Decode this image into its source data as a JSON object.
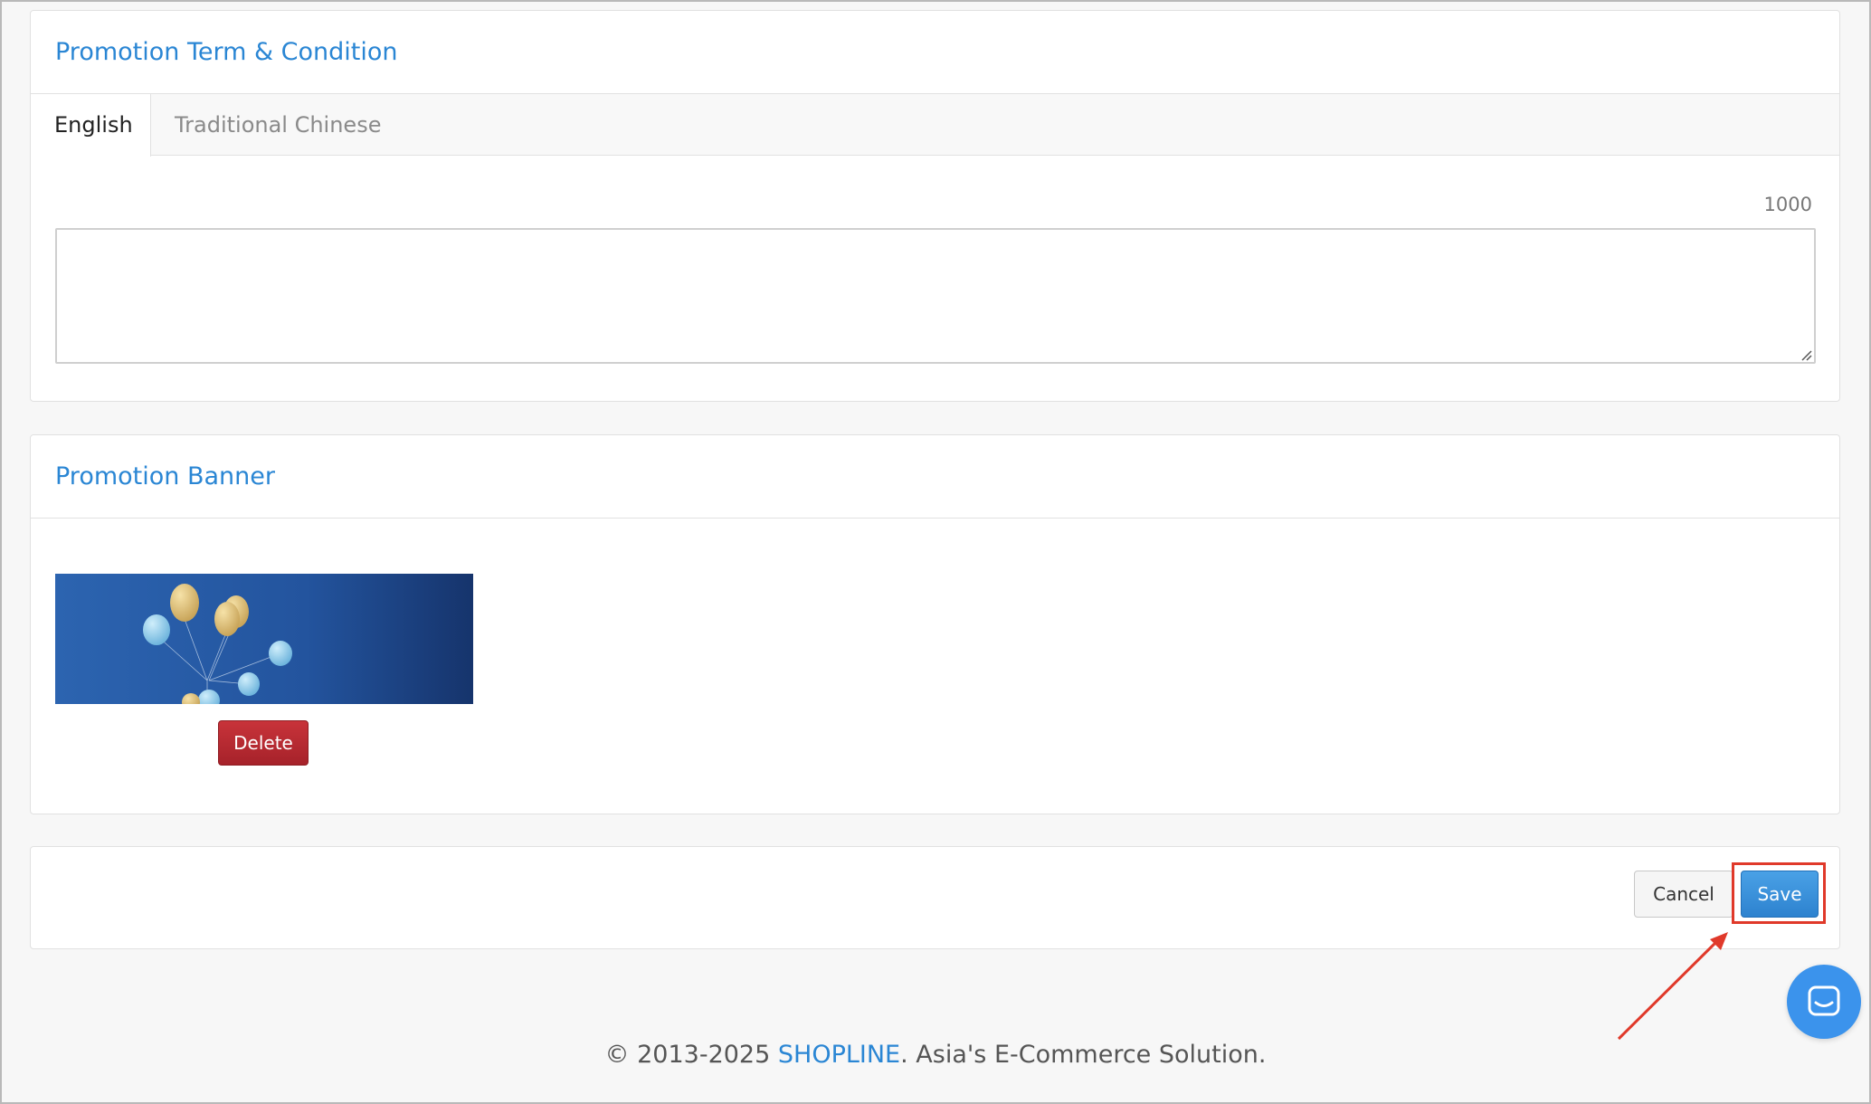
{
  "terms_panel": {
    "title": "Promotion Term & Condition",
    "tabs": [
      {
        "label": "English",
        "active": true
      },
      {
        "label": "Traditional Chinese",
        "active": false
      }
    ],
    "char_limit": "1000",
    "textarea_value": ""
  },
  "banner_panel": {
    "title": "Promotion Banner",
    "delete_label": "Delete"
  },
  "actions": {
    "cancel_label": "Cancel",
    "save_label": "Save"
  },
  "footer": {
    "prefix": "© 2013-2025 ",
    "brand": "SHOPLINE",
    "suffix": ". Asia's E-Commerce Solution."
  },
  "colors": {
    "accent": "#2a86d4",
    "danger": "#b3262e",
    "highlight": "#e0392a"
  },
  "icons": {
    "chat": "chat-bubble-icon",
    "resize": "resize-handle-icon",
    "arrow": "annotation-arrow"
  }
}
